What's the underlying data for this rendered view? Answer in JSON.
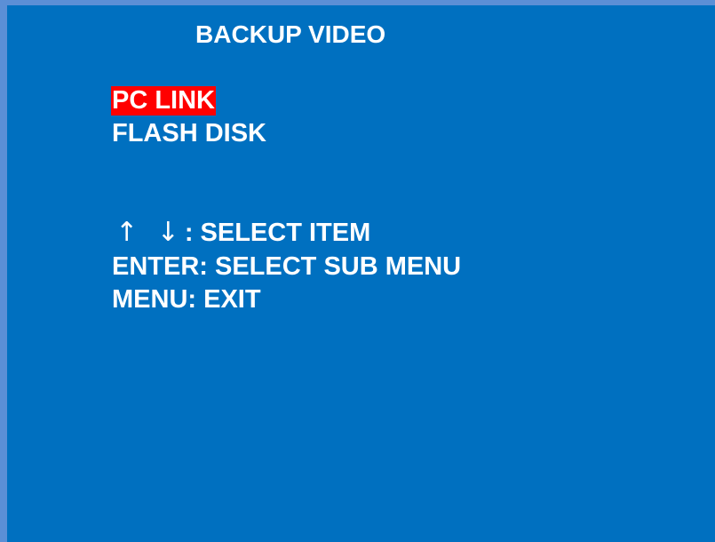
{
  "screen": {
    "title": "BACKUP VIDEO",
    "background_color": "#0070c0",
    "highlight_color": "#ff0000"
  },
  "menu": {
    "items": [
      {
        "label": "PC LINK",
        "selected": true
      },
      {
        "label": "FLASH DISK",
        "selected": false
      }
    ]
  },
  "help": {
    "arrows": "↑ ↓",
    "select_item": ": SELECT ITEM",
    "enter_line": "ENTER: SELECT SUB MENU",
    "menu_line": "MENU: EXIT"
  }
}
